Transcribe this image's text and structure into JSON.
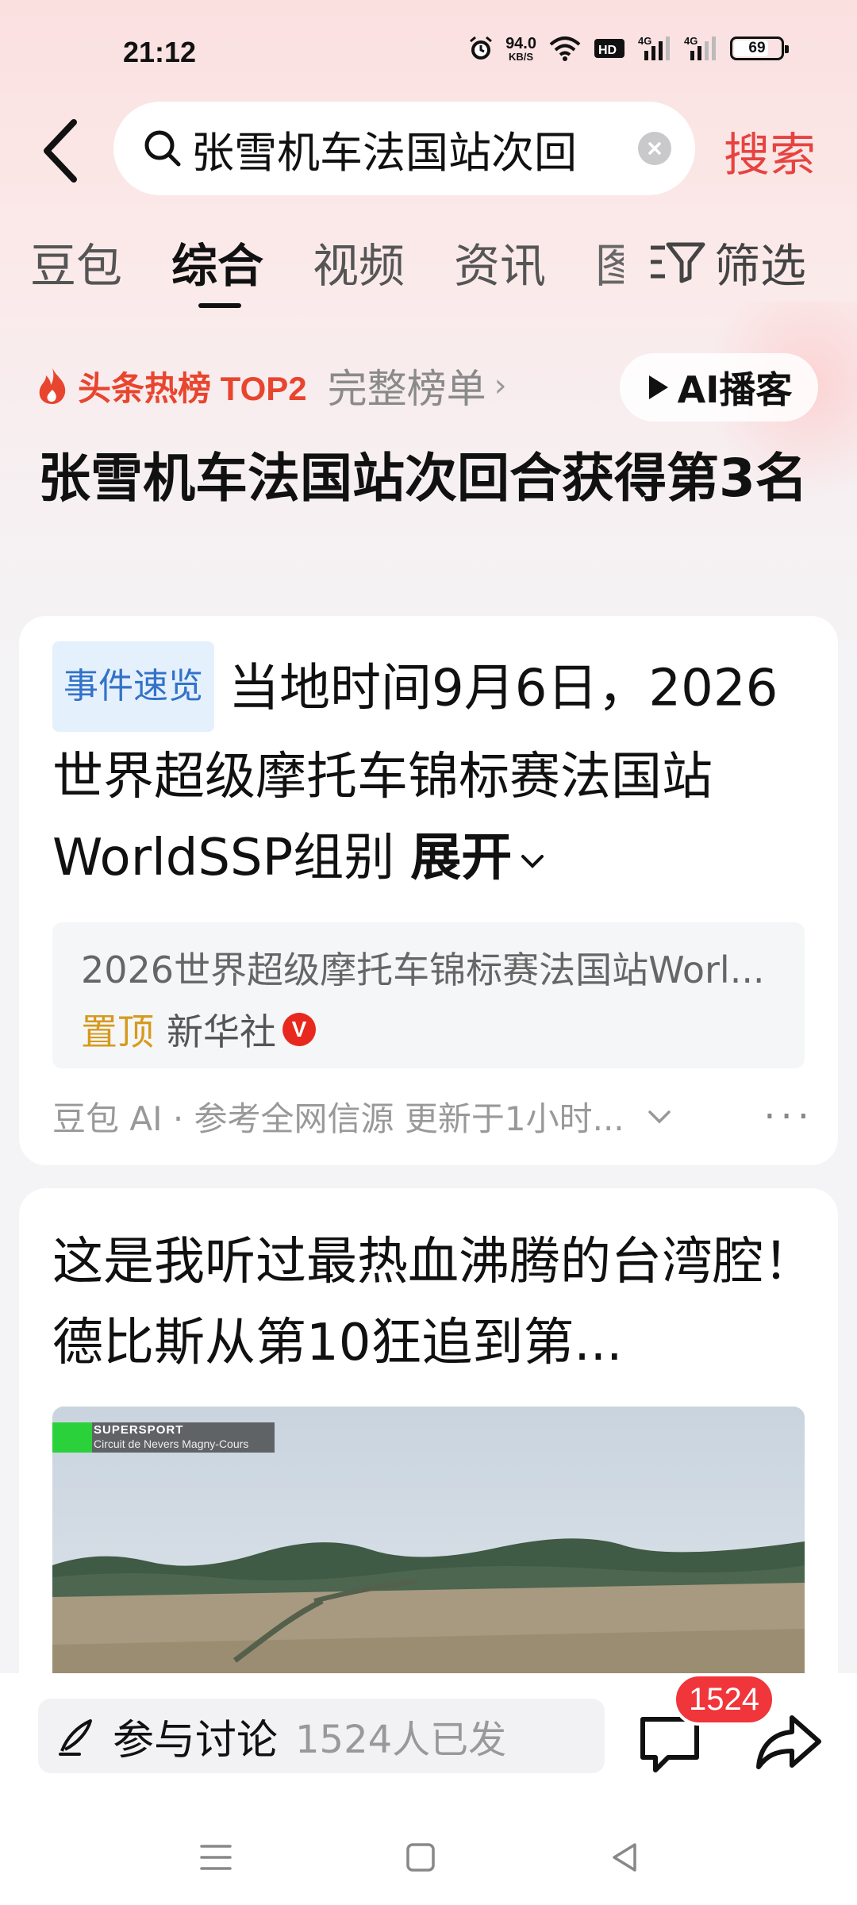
{
  "status_bar": {
    "time": "21:12",
    "net_speed_value": "94.0",
    "net_speed_unit": "KB/S",
    "hd_label": "HD",
    "signal1_label": "4G",
    "signal2_label": "4G",
    "battery_percent": "69",
    "battery_level": 0.69
  },
  "search": {
    "query": "张雪机车法国站次回",
    "search_button": "搜索"
  },
  "tabs": [
    {
      "label": "豆包",
      "active": false
    },
    {
      "label": "综合",
      "active": true
    },
    {
      "label": "视频",
      "active": false
    },
    {
      "label": "资讯",
      "active": false
    },
    {
      "label": "图",
      "active": false
    }
  ],
  "filter_label": "筛选",
  "hot": {
    "badge": "头条热榜 TOP2",
    "full_list": "完整榜单",
    "ai_podcast": "AI播客"
  },
  "page_title": "张雪机车法国站次回合获得第3名",
  "card1": {
    "badge": "事件速览",
    "summary": "当地时间9月6日，2026世界超级摩托车锦标赛法国站WorldSSP组别",
    "expand": "展开",
    "source_title": "2026世界超级摩托车锦标赛法国站Worl...",
    "pinned": "置顶",
    "publisher": "新华社",
    "verified": "V",
    "footer": "豆包 AI · 参考全网信源 更新于1小时..."
  },
  "card2": {
    "title": "这是我听过最热血沸腾的台湾腔！德比斯从第10狂追到第...",
    "thumb_label_1": "SUPERSPORT",
    "thumb_label_2": "Circuit de Nevers Magny-Cours"
  },
  "bottom": {
    "discuss_label": "参与讨论",
    "discuss_count": "1524人已发",
    "comment_count": "1524"
  },
  "colors": {
    "accent_red": "#e64340",
    "hot_orange": "#e8452f",
    "badge_blue": "#3272c8",
    "pinned_gold": "#d69a1e"
  },
  "icons": [
    "back-arrow-icon",
    "search-icon",
    "clear-icon",
    "filter-icon",
    "flame-icon",
    "play-icon",
    "pen-icon",
    "comment-icon",
    "share-icon",
    "menu-icon",
    "home-icon",
    "back-nav-icon"
  ]
}
